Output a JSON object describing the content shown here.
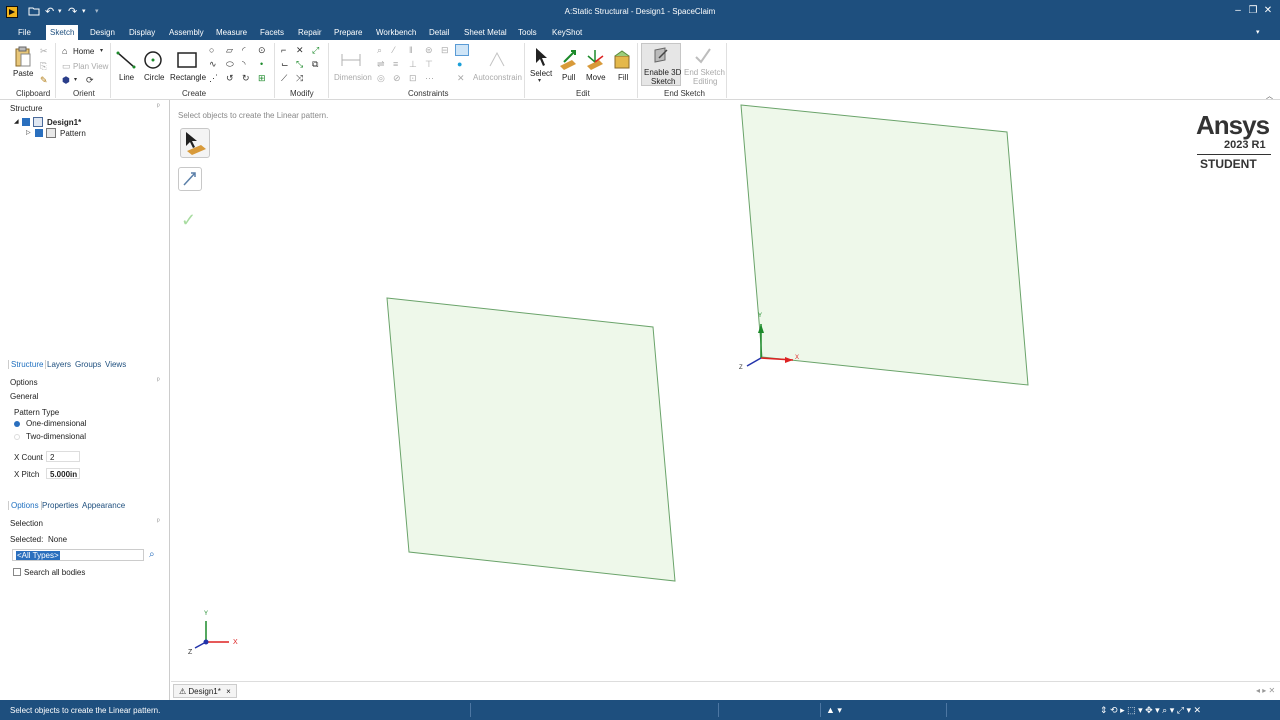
{
  "window": {
    "title": "A:Static Structural - Design1 - SpaceClaim"
  },
  "menu": {
    "items": [
      "File",
      "Sketch",
      "Design",
      "Display",
      "Assembly",
      "Measure",
      "Facets",
      "Repair",
      "Prepare",
      "Workbench",
      "Detail",
      "Sheet Metal",
      "Tools",
      "KeyShot"
    ],
    "active": "Sketch"
  },
  "ribbon": {
    "clipboard": {
      "paste": "Paste",
      "group": "Clipboard"
    },
    "orient": {
      "home": "Home",
      "plan_view": "Plan View",
      "group": "Orient"
    },
    "create": {
      "line": "Line",
      "circle": "Circle",
      "rectangle": "Rectangle",
      "group": "Create"
    },
    "modify": {
      "group": "Modify"
    },
    "constraints": {
      "dimension": "Dimension",
      "autoconstrain": "Autoconstrain",
      "group": "Constraints"
    },
    "edit": {
      "select": "Select",
      "pull": "Pull",
      "move": "Move",
      "fill": "Fill",
      "group": "Edit"
    },
    "end_sketch": {
      "enable_3d": "Enable 3D",
      "enable_3d_2": "Sketch",
      "end_editing": "End Sketch",
      "end_editing_2": "Editing",
      "group": "End Sketch"
    }
  },
  "structure": {
    "title": "Structure",
    "root": "Design1*",
    "child": "Pattern",
    "tabs": [
      "Structure",
      "Layers",
      "Groups",
      "Views"
    ]
  },
  "options": {
    "title": "Options",
    "section": "General",
    "pattern_type_label": "Pattern Type",
    "one_dim": "One-dimensional",
    "two_dim": "Two-dimensional",
    "x_count_label": "X Count",
    "x_count_value": "2",
    "x_pitch_label": "X Pitch",
    "x_pitch_value": "5.000in",
    "tabs": [
      "Options",
      "Properties",
      "Appearance"
    ]
  },
  "selection": {
    "title": "Selection",
    "selected_label": "Selected:",
    "selected_value": "None",
    "filter_value": "<All Types>",
    "search_all": "Search all bodies"
  },
  "viewport": {
    "hint": "Select objects to create the Linear pattern.",
    "axis_y": "Y",
    "axis_x": "X",
    "axis_z": "Z",
    "sheet_color": "#eef8ea",
    "sheet_edge": "#6aa36a"
  },
  "logo": {
    "brand": "Ansys",
    "version": "2023 R1",
    "edition": "STUDENT"
  },
  "doc_tab": {
    "label": "Design1*",
    "close": "×"
  },
  "status": {
    "text": "Select objects to create the Linear pattern."
  },
  "colors": {
    "chrome": "#1e4f7e",
    "accent": "#1e6fbf"
  }
}
